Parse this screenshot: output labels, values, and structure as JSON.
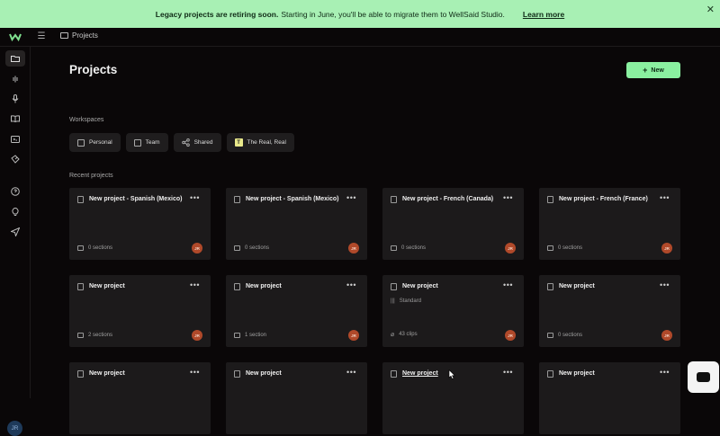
{
  "banner": {
    "bold": "Legacy projects are retiring soon.",
    "text": "Starting in June, you'll be able to migrate them to WellSaid Studio.",
    "link": "Learn more",
    "close": "✕"
  },
  "topbar": {
    "breadcrumb": "Projects"
  },
  "sidebar": {
    "avatar_initials": "JR"
  },
  "page": {
    "title": "Projects",
    "new_button": "New"
  },
  "workspaces": {
    "label": "Workspaces",
    "items": [
      {
        "label": "Personal",
        "icon": "person-icon"
      },
      {
        "label": "Team",
        "icon": "team-icon"
      },
      {
        "label": "Shared",
        "icon": "share-icon"
      },
      {
        "label": "The Real, Real",
        "icon": "badge",
        "badge": "T"
      }
    ]
  },
  "recent": {
    "label": "Recent projects",
    "cards": [
      {
        "title": "New project - Spanish (Mexico)",
        "meta": "0 sections",
        "owner": "JR"
      },
      {
        "title": "New project - Spanish (Mexico)",
        "meta": "0 sections",
        "owner": "JR"
      },
      {
        "title": "New project - French (Canada)",
        "meta": "0 sections",
        "owner": "JR"
      },
      {
        "title": "New project - French (France)",
        "meta": "0 sections",
        "owner": "JR"
      },
      {
        "title": "New project",
        "meta": "2 sections",
        "owner": "JR"
      },
      {
        "title": "New project",
        "meta": "1 section",
        "owner": "JR"
      },
      {
        "title": "New project",
        "subtitle": "Standard",
        "meta": "43 clips",
        "owner": "JR"
      },
      {
        "title": "New project",
        "meta": "0 sections",
        "owner": "JR"
      },
      {
        "title": "New project"
      },
      {
        "title": "New project"
      },
      {
        "title": "New project"
      },
      {
        "title": "New project"
      }
    ]
  },
  "colors": {
    "banner_bg": "#a8f0b4",
    "accent": "#8af0a0",
    "background": "#0a0708",
    "card": "#1c1a1b",
    "owner_avatar": "#b0492a"
  }
}
